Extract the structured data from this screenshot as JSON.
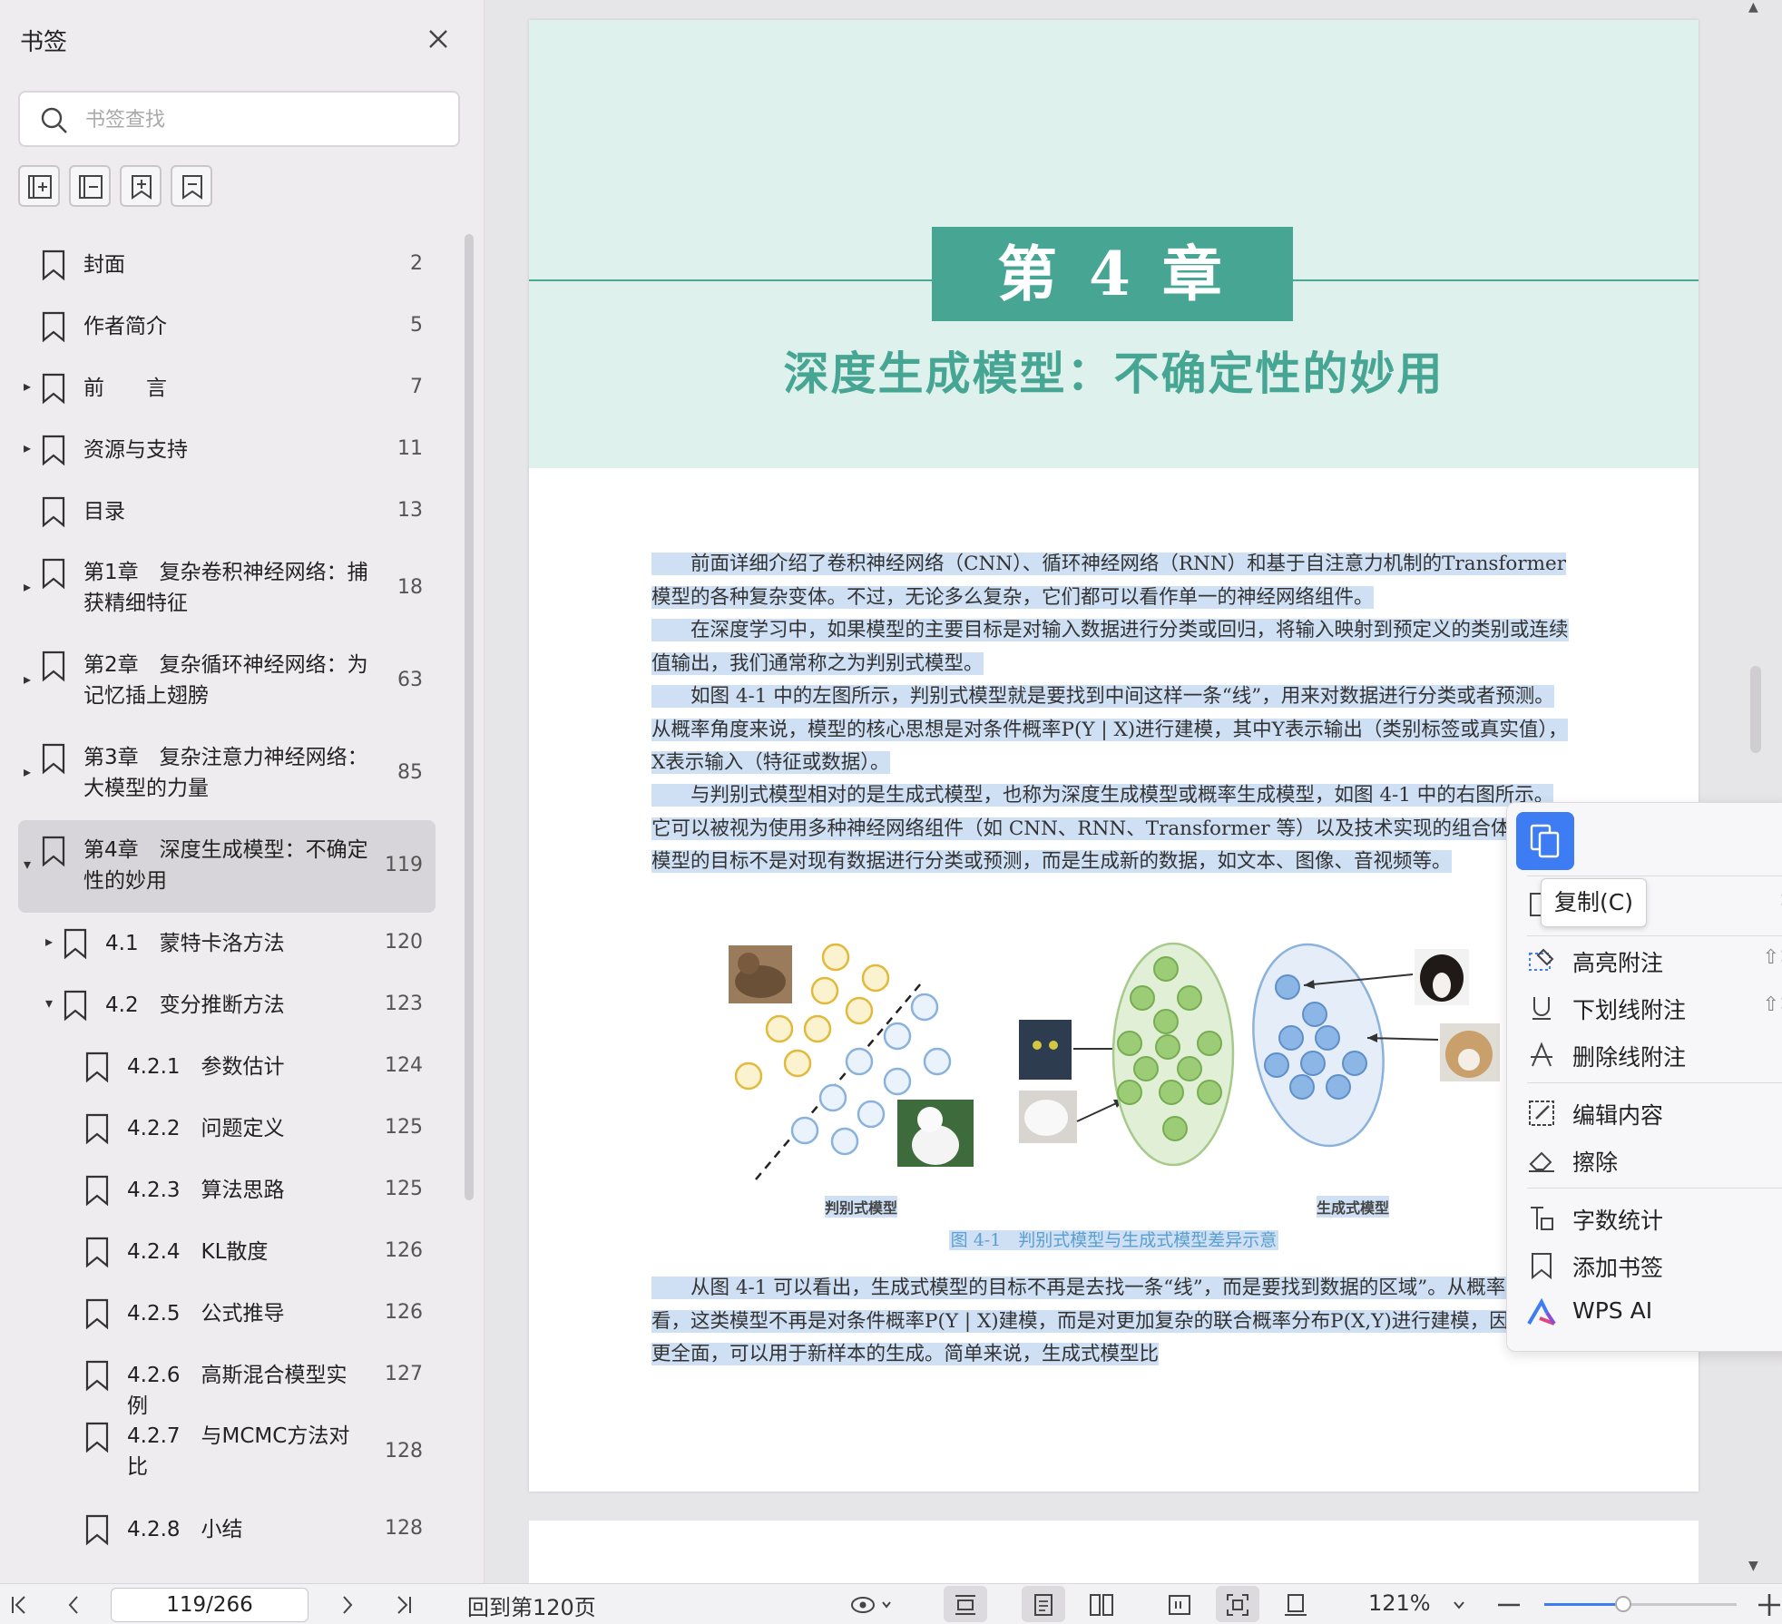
{
  "sidebar": {
    "title": "书签",
    "search_placeholder": "书签查找",
    "tools": [
      "expand-all-icon",
      "collapse-all-icon",
      "add-bookmark-icon",
      "bookmark-icon"
    ],
    "items": [
      {
        "label": "封面",
        "page": "2",
        "level": 0,
        "caret": ""
      },
      {
        "label": "作者简介",
        "page": "5",
        "level": 0,
        "caret": ""
      },
      {
        "label": "前　　言",
        "page": "7",
        "level": 0,
        "caret": "▸"
      },
      {
        "label": "资源与支持",
        "page": "11",
        "level": 0,
        "caret": "▸"
      },
      {
        "label": "目录",
        "page": "13",
        "level": 0,
        "caret": ""
      },
      {
        "label": "第1章　复杂卷积神经网络：捕获精细特征",
        "page": "18",
        "level": 0,
        "caret": "▸"
      },
      {
        "label": "第2章　复杂循环神经网络：为记忆插上翅膀",
        "page": "63",
        "level": 0,
        "caret": "▸"
      },
      {
        "label": "第3章　复杂注意力神经网络：大模型的力量",
        "page": "85",
        "level": 0,
        "caret": "▸"
      },
      {
        "label": "第4章　深度生成模型：不确定性的妙用",
        "page": "119",
        "level": 0,
        "caret": "▾",
        "active": true
      },
      {
        "label": "4.1　蒙特卡洛方法",
        "page": "120",
        "level": 1,
        "caret": "▸"
      },
      {
        "label": "4.2　变分推断方法",
        "page": "123",
        "level": 1,
        "caret": "▾"
      },
      {
        "label": "4.2.1　参数估计",
        "page": "124",
        "level": 2,
        "caret": ""
      },
      {
        "label": "4.2.2　问题定义",
        "page": "125",
        "level": 2,
        "caret": ""
      },
      {
        "label": "4.2.3　算法思路",
        "page": "125",
        "level": 2,
        "caret": ""
      },
      {
        "label": "4.2.4　KL散度",
        "page": "126",
        "level": 2,
        "caret": ""
      },
      {
        "label": "4.2.5　公式推导",
        "page": "126",
        "level": 2,
        "caret": ""
      },
      {
        "label": "4.2.6　高斯混合模型实例",
        "page": "127",
        "level": 2,
        "caret": ""
      },
      {
        "label": "4.2.7　与MCMC方法对比",
        "page": "128",
        "level": 2,
        "caret": ""
      },
      {
        "label": "4.2.8　小结",
        "page": "128",
        "level": 2,
        "caret": ""
      }
    ]
  },
  "document": {
    "chapter_number": "第 4 章",
    "chapter_title": "深度生成模型：不确定性的妙用",
    "paragraphs": [
      "　　前面详细介绍了卷积神经网络（CNN）、循环神经网络（RNN）和基于自注意力机制的Transformer 模型的各种复杂变体。不过，无论多么复杂，它们都可以看作单一的神经网络组件。",
      "　　在深度学习中，如果模型的主要目标是对输入数据进行分类或回归，将输入映射到预定义的类别或连续值输出，我们通常称之为判别式模型。",
      "　　如图 4-1 中的左图所示，判别式模型就是要找到中间这样一条“线”，用来对数据进行分类或者预测。从概率角度来说，模型的核心思想是对条件概率P(Y | X)进行建模，其中Y表示输出（类别标签或真实值），X表示输入（特征或数据）。",
      "　　与判别式模型相对的是生成式模型，也称为深度生成模型或概率生成模型，如图 4-1 中的右图所示。它可以被视为使用多种神经网络组件（如 CNN、RNN、Transformer 等）以及技术实现的组合体。这类模型的目标不是对现有数据进行分类或预测，而是生成新的数据，如文本、图像、音视频等。",
      "　　从图 4-1 可以看出，生成式模型的目标不再是去找一条“线”，而是要找到数据的区域”。从概率角度来看，这类模型不再是对条件概率P(Y | X)建模，而是对更加复杂的联合概率分布P(X,Y)进行建模，因为后者更全面，可以用于新样本的生成。简单来说，生成式模型比"
    ],
    "figure": {
      "left_label": "判别式模型",
      "right_label": "生成式模型",
      "caption": "图 4-1　判别式模型与生成式模型差异示意"
    }
  },
  "context_menu": {
    "tooltip": "复制(C)",
    "items": [
      {
        "label": "高亮附注",
        "shortcut": "⇧⌘",
        "icon": "highlight-icon"
      },
      {
        "label": "下划线附注",
        "shortcut": "⇧⌘",
        "icon": "underline-icon"
      },
      {
        "label": "删除线附注",
        "shortcut": "",
        "icon": "strikethrough-icon"
      },
      {
        "label": "编辑内容",
        "shortcut": "",
        "icon": "edit-content-icon"
      },
      {
        "label": "擦除",
        "shortcut": "",
        "icon": "eraser-icon"
      },
      {
        "label": "字数统计",
        "shortcut": "",
        "icon": "word-count-icon"
      },
      {
        "label": "添加书签",
        "shortcut": "",
        "icon": "add-bookmark-icon"
      },
      {
        "label": "WPS AI",
        "shortcut": "",
        "icon": "wps-ai-icon"
      }
    ]
  },
  "statusbar": {
    "page_value": "119/266",
    "back_to_page": "回到第120页",
    "zoom": "121%",
    "zoom_slider_value": 0.41,
    "accent": "#3d7cf2"
  },
  "colors": {
    "chapter_accent": "#46a693",
    "selection": "#cfe0f5"
  }
}
